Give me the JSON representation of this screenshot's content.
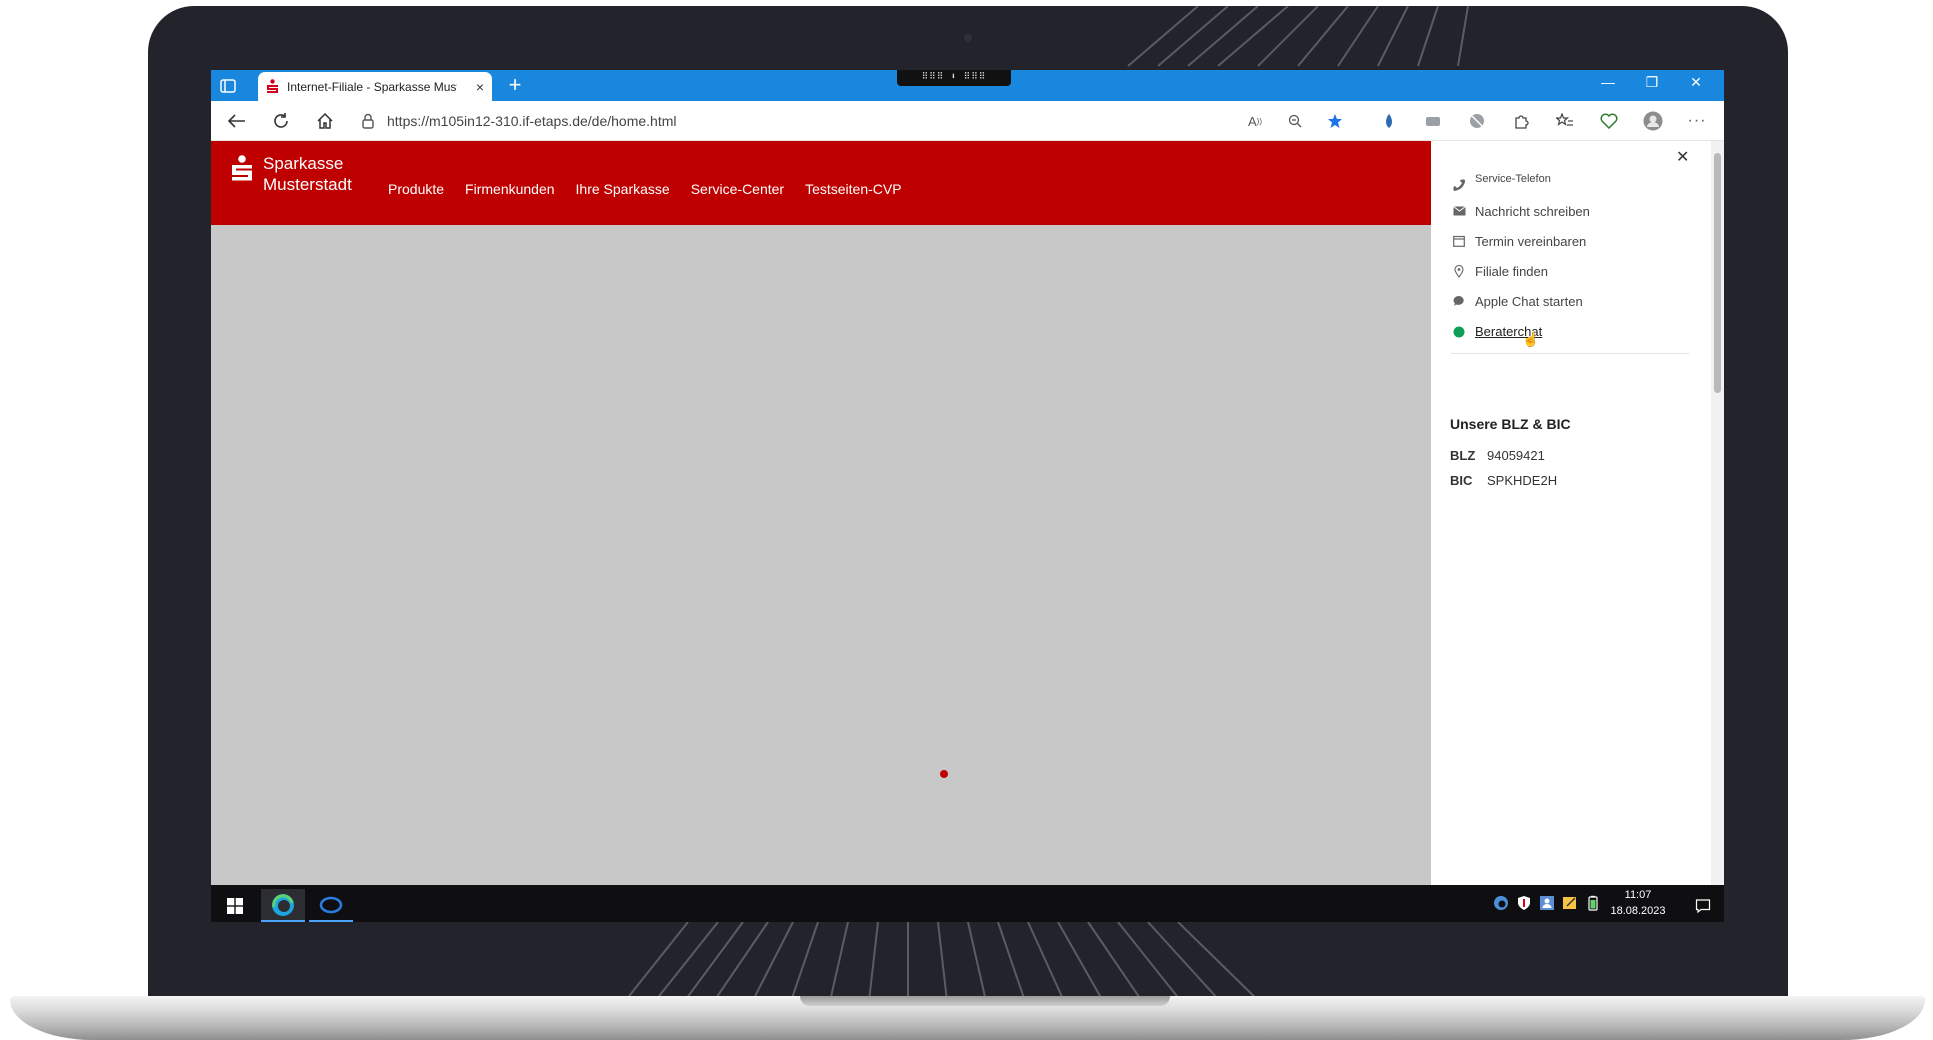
{
  "browser": {
    "tab_title": "Internet-Filiale - Sparkasse Must",
    "tab_close": "×",
    "new_tab": "+",
    "drag_handle": "⠿⠿⠿ ⬇ ⠿⠿⠿",
    "url": "https://m105in12-310.if-etaps.de/de/home.html",
    "window_controls": {
      "minimize": "—",
      "restore": "❐",
      "close": "✕"
    }
  },
  "site": {
    "brand_line1": "Sparkasse",
    "brand_line2": "Musterstadt",
    "nav": [
      "Produkte",
      "Firmenkunden",
      "Ihre Sparkasse",
      "Service-Center",
      "Testseiten-CVP"
    ],
    "brand_color": "#be0000"
  },
  "side_panel": {
    "close": "✕",
    "items": [
      {
        "label": "Service-Telefon",
        "icon": "phone-icon"
      },
      {
        "label": "Nachricht schreiben",
        "icon": "mail-icon"
      },
      {
        "label": "Termin vereinbaren",
        "icon": "calendar-icon"
      },
      {
        "label": "Filiale finden",
        "icon": "location-pin-icon"
      },
      {
        "label": "Apple Chat starten",
        "icon": "chat-bubble-icon"
      },
      {
        "label": "Beraterchat",
        "icon": "status-dot-icon"
      }
    ],
    "bank_heading": "Unsere BLZ & BIC",
    "blz_label": "BLZ",
    "blz_value": "94059421",
    "bic_label": "BIC",
    "bic_value": "SPKHDE2H"
  },
  "taskbar": {
    "time": "11:07",
    "date": "18.08.2023"
  }
}
